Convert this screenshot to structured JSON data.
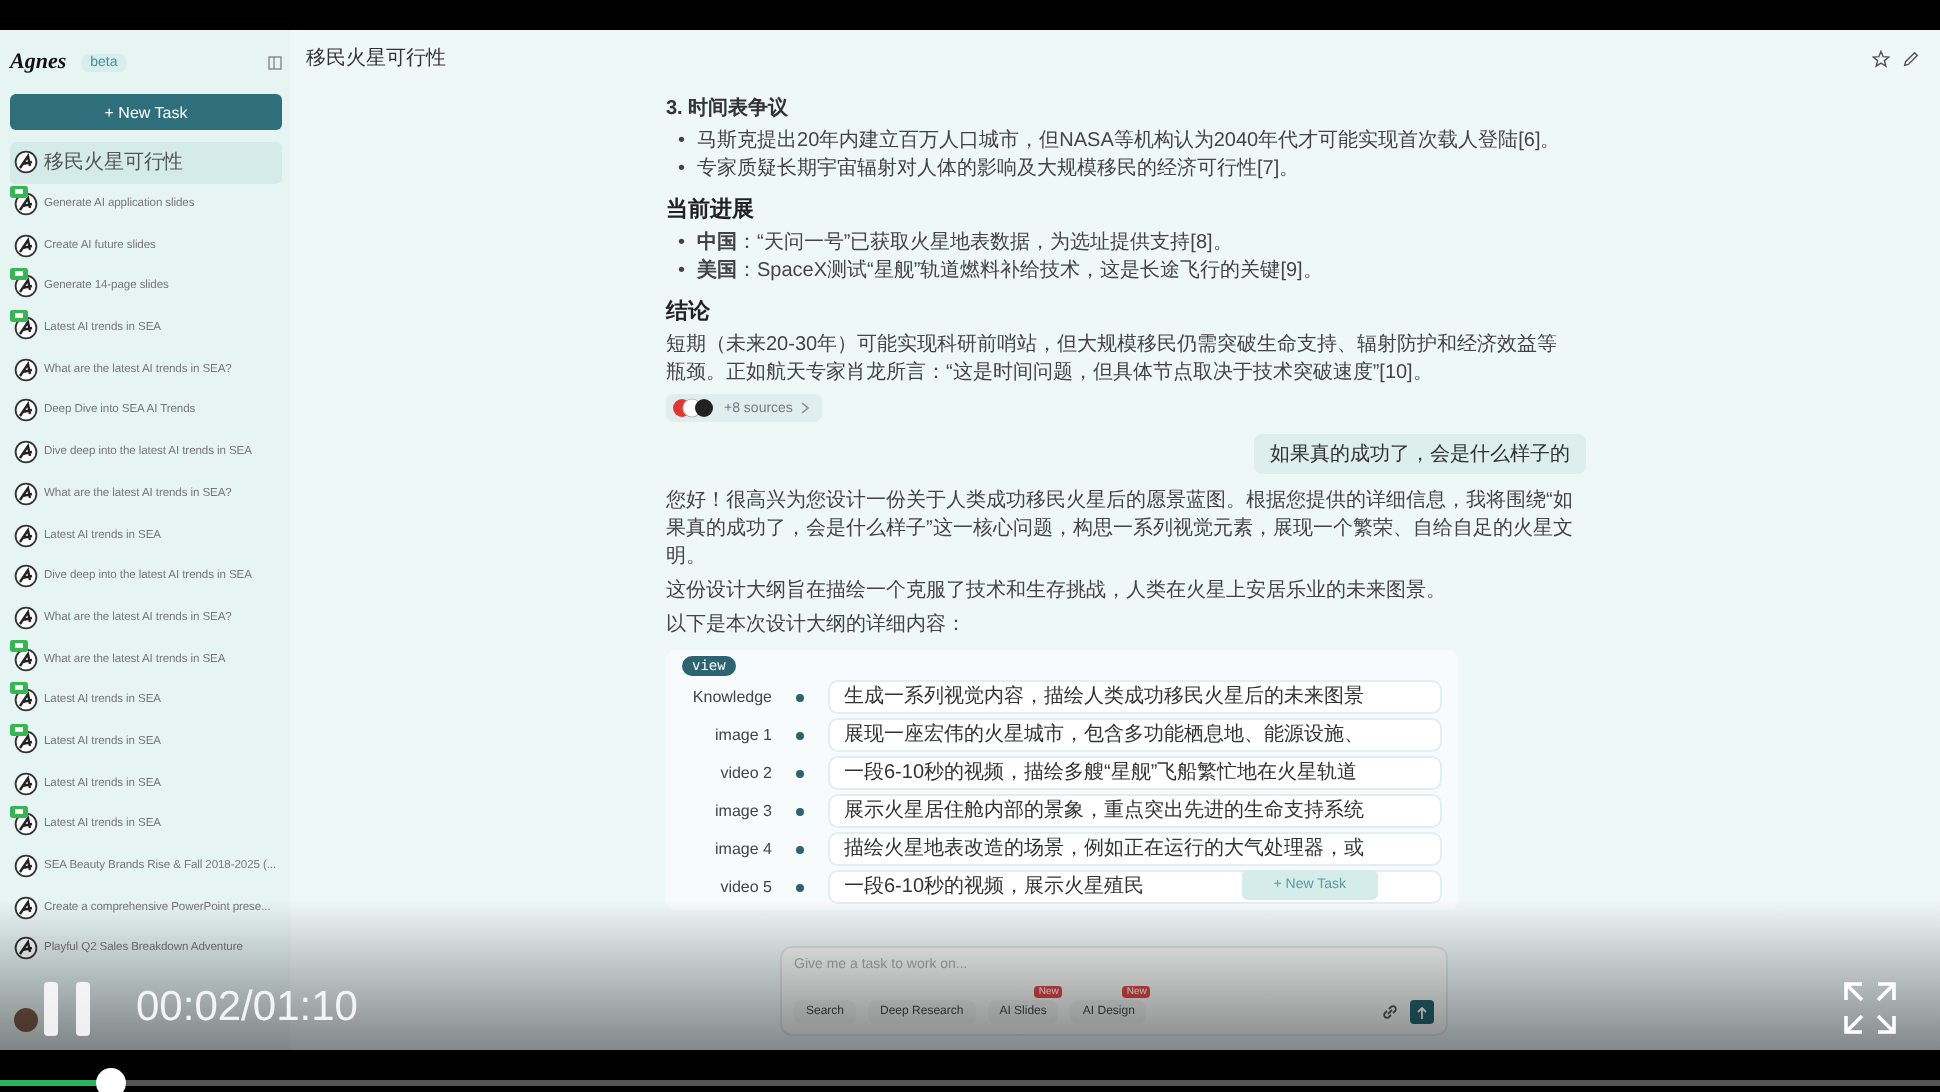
{
  "sidebar": {
    "logo": "Agnes",
    "tag": "beta",
    "new_task": "+ New Task",
    "items": [
      {
        "label": "移民火星可行性",
        "selected": true,
        "badge": false
      },
      {
        "label": "Generate AI application slides",
        "selected": false,
        "badge": true
      },
      {
        "label": "Create AI future slides",
        "selected": false,
        "badge": false
      },
      {
        "label": "Generate 14-page slides",
        "selected": false,
        "badge": true
      },
      {
        "label": "Latest AI trends in SEA",
        "selected": false,
        "badge": true
      },
      {
        "label": "What are the latest AI trends in SEA?",
        "selected": false,
        "badge": false
      },
      {
        "label": "Deep Dive into SEA AI Trends",
        "selected": false,
        "badge": false
      },
      {
        "label": "Dive deep into the latest AI trends in SEA",
        "selected": false,
        "badge": false
      },
      {
        "label": "What are the latest AI trends in SEA?",
        "selected": false,
        "badge": false
      },
      {
        "label": "Latest AI trends in SEA",
        "selected": false,
        "badge": false
      },
      {
        "label": "Dive deep into the latest AI trends in SEA",
        "selected": false,
        "badge": false
      },
      {
        "label": "What are the latest AI trends in SEA?",
        "selected": false,
        "badge": false
      },
      {
        "label": "What are the latest AI trends in SEA",
        "selected": false,
        "badge": true
      },
      {
        "label": "Latest AI trends in SEA",
        "selected": false,
        "badge": true
      },
      {
        "label": "Latest AI trends in SEA",
        "selected": false,
        "badge": true
      },
      {
        "label": "Latest AI trends in SEA",
        "selected": false,
        "badge": false
      },
      {
        "label": "Latest AI trends in SEA",
        "selected": false,
        "badge": true
      },
      {
        "label": "SEA Beauty Brands Rise & Fall 2018-2025 (...",
        "selected": false,
        "badge": false
      },
      {
        "label": "Create a comprehensive PowerPoint prese...",
        "selected": false,
        "badge": false
      },
      {
        "label": "Playful Q2 Sales Breakdown Adventure",
        "selected": false,
        "badge": false
      }
    ]
  },
  "header": {
    "title": "移民火星可行性"
  },
  "blocks": [
    {
      "kind": "subheading",
      "text": "3. 时间表争议"
    },
    {
      "kind": "bullets",
      "marker": "•",
      "items": [
        "马斯克提出20年内建立百万人口城市，但NASA等机构认为2040年代才可能实现首次载人登陆[6]。",
        "专家质疑长期宇宙辐射对人体的影响及大规模移民的经济可行性[7]。"
      ]
    },
    {
      "kind": "heading",
      "text": "当前进展"
    },
    {
      "kind": "bullets",
      "marker": "•",
      "items": [
        "**中国**：“天问一号”已获取火星地表数据，为选址提供支持[8]。",
        "**美国**：SpaceX测试“星舰”轨道燃料补给技术，这是长途飞行的关键[9]。"
      ]
    },
    {
      "kind": "heading",
      "text": "结论"
    },
    {
      "kind": "paragraph",
      "text": "短期（未来20-30年）可能实现科研前哨站，但大规模移民仍需突破生命支持、辐射防护和经济效益等瓶颈。正如航天专家肖龙所言：“这是时间问题，但具体节点取决于技术突破速度”[10]。"
    },
    {
      "kind": "sources",
      "text": "+8 sources"
    },
    {
      "kind": "user",
      "text": "如果真的成功了，会是什么样子的"
    },
    {
      "kind": "paragraph",
      "text": "您好！很高兴为您设计一份关于人类成功移民火星后的愿景蓝图。根据您提供的详细信息，我将围绕“如果真的成功了，会是什么样子”这一核心问题，构思一系列视觉元素，展现一个繁荣、自给自足的火星文明。"
    },
    {
      "kind": "paragraph",
      "text": "这份设计大纲旨在描绘一个克服了技术和生存挑战，人类在火星上安居乐业的未来图景。"
    },
    {
      "kind": "paragraph",
      "text": "以下是本次设计大纲的详细内容："
    },
    {
      "kind": "card",
      "tag": "view",
      "floating_button": "+ New Task",
      "rows": [
        {
          "label": "Knowledge",
          "text": "生成一系列视觉内容，描绘人类成功移民火星后的未来图景"
        },
        {
          "label": "image 1",
          "text": "展现一座宏伟的火星城市，包含多功能栖息地、能源设施、"
        },
        {
          "label": "video 2",
          "text": "一段6-10秒的视频，描绘多艘“星舰”飞船繁忙地在火星轨道"
        },
        {
          "label": "image 3",
          "text": "展示火星居住舱内部的景象，重点突出先进的生命支持系统"
        },
        {
          "label": "image 4",
          "text": "描绘火星地表改造的场景，例如正在运行的大气处理器，或"
        },
        {
          "label": "video 5",
          "text": "一段6-10秒的视频，展示火星殖民"
        }
      ]
    }
  ],
  "composer": {
    "placeholder": "Give me a task to work on...",
    "tools": [
      {
        "label": "Search"
      },
      {
        "label": "Deep Research"
      },
      {
        "label": "AI Slides",
        "badge": "New"
      },
      {
        "label": "AI Design",
        "badge": "New"
      }
    ]
  },
  "video": {
    "time": "00:02/01:10",
    "level": 0.057,
    "playing": true
  }
}
